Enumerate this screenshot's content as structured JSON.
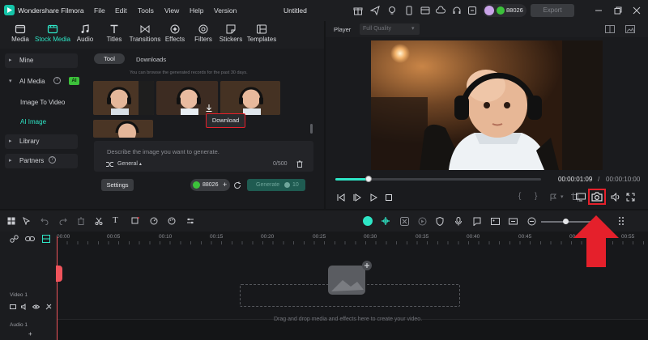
{
  "app": {
    "name": "Wondershare Filmora",
    "project_title": "Untitled",
    "credits": "88026",
    "export_label": "Export"
  },
  "menu": [
    "File",
    "Edit",
    "Tools",
    "View",
    "Help",
    "Version"
  ],
  "media_tabs": [
    {
      "label": "Media",
      "icon": "media-icon"
    },
    {
      "label": "Stock Media",
      "icon": "stock-media-icon"
    },
    {
      "label": "Audio",
      "icon": "music-note-icon"
    },
    {
      "label": "Titles",
      "icon": "text-t-icon"
    },
    {
      "label": "Transitions",
      "icon": "transitions-icon"
    },
    {
      "label": "Effects",
      "icon": "effects-icon"
    },
    {
      "label": "Filters",
      "icon": "filters-icon"
    },
    {
      "label": "Stickers",
      "icon": "stickers-icon"
    },
    {
      "label": "Templates",
      "icon": "templates-icon"
    }
  ],
  "sidebar": {
    "mine": "Mine",
    "ai_media": "AI Media",
    "ai_badge": "AI",
    "image_to_video": "Image To Video",
    "ai_image": "AI Image",
    "library": "Library",
    "partners": "Partners"
  },
  "content": {
    "tabs": [
      "Tool",
      "Downloads"
    ],
    "notice": "You can browse the generated records for the past 30 days.",
    "download_tooltip": "Download",
    "prompt_placeholder": "Describe the image you want to generate.",
    "style": "General",
    "char_count": "0/500",
    "settings_label": "Settings",
    "credits": "88026",
    "generate_label": "Generate",
    "generate_cost": "10"
  },
  "player": {
    "label": "Player",
    "quality": "Full Quality",
    "progress": 0.16,
    "current_time": "00:00:01:09",
    "separator": "/",
    "total_time": "00:00:10:00"
  },
  "timeline": {
    "ruler": [
      "00:00",
      "00:05",
      "00:10",
      "00:15",
      "00:20",
      "00:25",
      "00:30",
      "00:35",
      "00:40",
      "00:45",
      "00:50",
      "00:55"
    ],
    "video_track": "Video 1",
    "audio_track": "Audio 1",
    "drop_hint": "Drag and drop media and effects here to create your video.",
    "zoom_level": 0.45
  },
  "colors": {
    "accent": "#2ee6c6",
    "highlight_red": "#e5202b",
    "playhead": "#f0545c"
  }
}
